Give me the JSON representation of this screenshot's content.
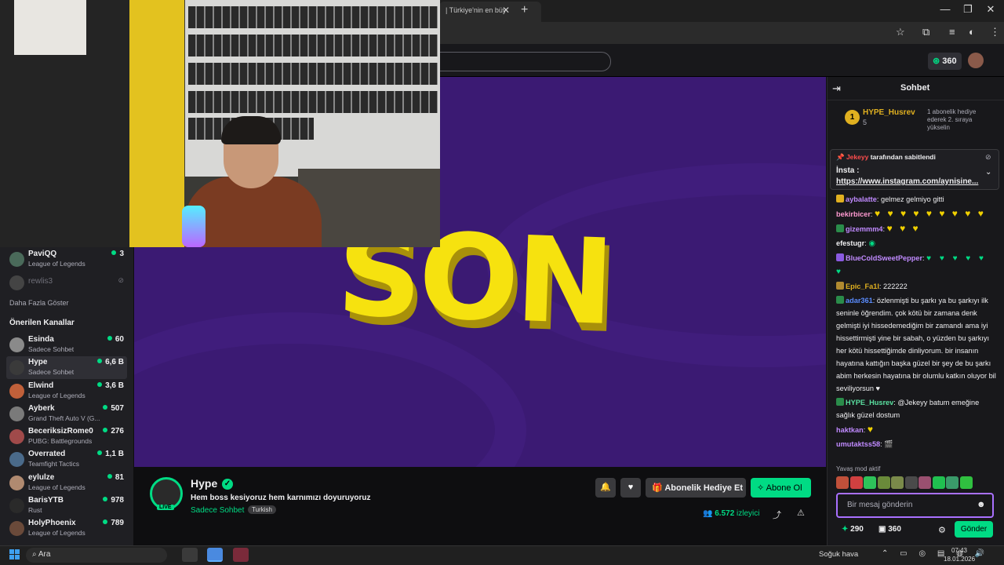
{
  "browser": {
    "tab_title": "| Türkiye'nin en büy",
    "tab_close": "✕",
    "new_tab": "+",
    "window_controls": [
      "—",
      "❐",
      "✕"
    ],
    "toolbar_icons": [
      "star-icon",
      "extensions-icon",
      "playlist-icon",
      "profile-icon",
      "menu-icon"
    ],
    "toolbar_glyphs": [
      "☆",
      "⧉",
      "≡",
      "◐",
      "⋮"
    ]
  },
  "topnav": {
    "points": "360",
    "points_icon": "⊛"
  },
  "sidebar": {
    "top_channels": [
      {
        "name": "PaviQQ",
        "game": "League of Legends",
        "viewers": "3",
        "online": true
      },
      {
        "name": "rewlis3",
        "game": "",
        "viewers": "",
        "online": false
      }
    ],
    "show_more": "Daha Fazla Göster",
    "recommended_heading": "Önerilen Kanallar",
    "recommended": [
      {
        "name": "Esinda",
        "game": "Sadece Sohbet",
        "viewers": "60",
        "color": "#8a8a8a"
      },
      {
        "name": "Hype",
        "game": "Sadece Sohbet",
        "viewers": "6,6 B",
        "color": "#3a3a3a"
      },
      {
        "name": "Elwind",
        "game": "League of Legends",
        "viewers": "3,6 B",
        "color": "#c0603a"
      },
      {
        "name": "Ayberk",
        "game": "Grand Theft Auto V (G...",
        "viewers": "507",
        "color": "#7a7a7a"
      },
      {
        "name": "BeceriksizRome0",
        "game": "PUBG: Battlegrounds",
        "viewers": "276",
        "color": "#a04a4a"
      },
      {
        "name": "Overrated",
        "game": "Teamfight Tactics",
        "viewers": "1,1 B",
        "color": "#4a6a8a"
      },
      {
        "name": "eylulze",
        "game": "League of Legends",
        "viewers": "81",
        "color": "#b08a70"
      },
      {
        "name": "BarisYTB",
        "game": "Rust",
        "viewers": "978",
        "color": "#2a2a2a"
      },
      {
        "name": "HolyPhoenix",
        "game": "League of Legends",
        "viewers": "789",
        "color": "#6a4a3a"
      }
    ]
  },
  "player": {
    "overlay_text": "SON"
  },
  "stream": {
    "streamer": "Hype",
    "live_label": "LIVE",
    "verified_glyph": "✓",
    "title": "Hem boss kesiyoruz hem karnımızı doyuruyoruz",
    "category": "Sadece Sohbet",
    "language_tag": "Turkish",
    "notify_glyph": "🔔",
    "follow_glyph": "♥",
    "gift_label": "Abonelik Hediye Et",
    "gift_glyph": "🎁",
    "subscribe_label": "Abone Ol",
    "subscribe_glyph": "✧",
    "viewer_glyph": "👥",
    "viewer_count": "6.572",
    "viewer_word": "izleyici",
    "share_glyph": "⤴",
    "report_glyph": "⚠"
  },
  "chat": {
    "title": "Sohbet",
    "collapse_glyph": "⇥",
    "leaderboard": {
      "rank": "1",
      "user": "HYPE_Husrev",
      "count": "5",
      "note": "1 abonelik hediye ederek 2. sıraya yükselin"
    },
    "pinned": {
      "by_user": "Jekeyy",
      "by_text": "tarafından sabitlendi",
      "line1": "İnsta :",
      "link": "https://www.instagram.com/aynisine...",
      "chevron": "⌄",
      "hide_glyph": "⊘"
    },
    "messages": [
      {
        "user": "aybalatte",
        "color": "#c08aff",
        "text": "gelmez gelmiyo gitti",
        "decor": ""
      },
      {
        "user": "bekirbicer",
        "color": "#ff9ad0",
        "text": "",
        "decor": "♥ ♥ ♥ ♥ ♥ ♥ ♥ ♥ ♥"
      },
      {
        "user": "gizemmm4",
        "color": "#c08aff",
        "text": "",
        "decor": "♥ ♥ ♥"
      },
      {
        "user": "efestugr",
        "color": "#efeff1",
        "text": "◉",
        "decor": ""
      },
      {
        "user": "BlueColdSweetPepper",
        "color": "#c08aff",
        "text": "♥ ♥ ♥ ♥ ♥ ♥",
        "decor": ""
      },
      {
        "user": "Epic_Fa1l",
        "color": "#e0b020",
        "text": "222222",
        "decor": ""
      },
      {
        "user": "adar361",
        "color": "#5a8cff",
        "text": "özlenmişti bu şarkı ya bu şarkıyı ilk seninle öğrendim. çok kötü bir zamana denk gelmişti iyi hissedemediğim bir zamandı ama iyi hissettirmişti yine bir sabah, o yüzden bu şarkıyı her kötü hissettiğimde dinliyorum. bir insanın hayatına kattığın başka güzel bir şey de bu şarkı abim herkesin hayatına bir olumlu katkın oluyor bil seviliyorsun ♥",
        "decor": ""
      },
      {
        "user": "HYPE_Husrev",
        "color": "#5ae0a0",
        "text": "@Jekeyy batum emeğine sağlık güzel dostum",
        "decor": ""
      },
      {
        "user": "haktkan",
        "color": "#c08aff",
        "text": "",
        "decor": "♥"
      },
      {
        "user": "umutaktss58",
        "color": "#c08aff",
        "text": "🎬",
        "decor": ""
      }
    ],
    "slow_mode": "Yavaş mod aktif",
    "input_placeholder": "Bir mesaj gönderin",
    "emote_glyph": "☻",
    "points": "290",
    "gift_count": "360",
    "settings_glyph": "⚙",
    "send_label": "Gönder",
    "emote_colors": [
      "#c0503a",
      "#d04040",
      "#2ec25a",
      "#6a8a3a",
      "#7a8a4a",
      "#4a4a4a",
      "#9a5070",
      "#20c050",
      "#3a9a6a",
      "#30c040"
    ]
  },
  "taskbar": {
    "search_label": "Ara",
    "search_glyph": "⌕",
    "weather": "Soğuk hava",
    "tray": "⌃ ▭ ◎ ▤ ◍ 🔊",
    "time": "07:43",
    "date": "18.01.2026"
  }
}
